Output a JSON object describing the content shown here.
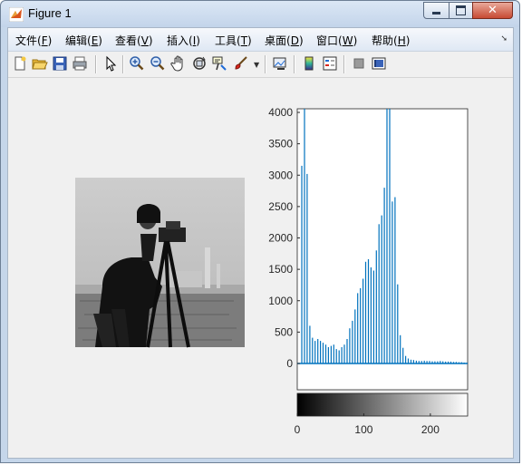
{
  "window": {
    "title": "Figure 1"
  },
  "menu": {
    "items": [
      {
        "text": "文件(",
        "key": "F",
        "close": ")"
      },
      {
        "text": "编辑(",
        "key": "E",
        "close": ")"
      },
      {
        "text": "查看(",
        "key": "V",
        "close": ")"
      },
      {
        "text": "插入(",
        "key": "I",
        "close": ")"
      },
      {
        "text": "工具(",
        "key": "T",
        "close": ")"
      },
      {
        "text": "桌面(",
        "key": "D",
        "close": ")"
      },
      {
        "text": "窗口(",
        "key": "W",
        "close": ")"
      },
      {
        "text": "帮助(",
        "key": "H",
        "close": ")"
      }
    ]
  },
  "toolbar": {
    "icons": [
      "new-figure-icon",
      "open-file-icon",
      "save-icon",
      "print-icon",
      "pointer-icon",
      "zoom-in-icon",
      "zoom-out-icon",
      "pan-icon",
      "rotate-3d-icon",
      "data-cursor-icon",
      "brush-icon",
      "brush-dropdown-icon",
      "link-plot-icon",
      "colorbar-icon",
      "legend-icon",
      "hide-plot-tools-icon",
      "show-plot-tools-icon"
    ]
  },
  "colors": {
    "bar": "#0072bd",
    "axes_bg": "#ffffff",
    "figure_bg": "#f0f0f0"
  },
  "chart_data": {
    "type": "bar",
    "title": "",
    "xlabel": "",
    "ylabel": "",
    "xlim": [
      0,
      256
    ],
    "ylim": [
      0,
      4100
    ],
    "yticks": [
      0,
      500,
      1000,
      1500,
      2000,
      2500,
      3000,
      3500,
      4000
    ],
    "xticks": [
      0,
      100,
      200
    ],
    "colorbar": "grayscale 0-255 below x axis",
    "x": [
      0,
      4,
      8,
      12,
      16,
      20,
      24,
      28,
      32,
      36,
      40,
      44,
      48,
      52,
      56,
      60,
      64,
      68,
      72,
      76,
      80,
      84,
      88,
      92,
      96,
      100,
      104,
      108,
      112,
      116,
      120,
      124,
      128,
      132,
      136,
      140,
      144,
      148,
      152,
      156,
      160,
      164,
      168,
      172,
      176,
      180,
      184,
      188,
      192,
      196,
      200,
      204,
      208,
      212,
      216,
      220,
      224,
      228,
      232,
      236,
      240,
      244,
      248,
      252
    ],
    "values": [
      0,
      3150,
      4100,
      3020,
      600,
      410,
      360,
      390,
      360,
      330,
      300,
      260,
      280,
      300,
      230,
      210,
      260,
      300,
      390,
      560,
      680,
      860,
      1120,
      1200,
      1350,
      1620,
      1660,
      1530,
      1480,
      1800,
      2220,
      2360,
      2800,
      4100,
      4100,
      2580,
      2650,
      1260,
      450,
      250,
      120,
      80,
      60,
      55,
      45,
      40,
      40,
      45,
      40,
      40,
      35,
      35,
      35,
      40,
      35,
      30,
      30,
      30,
      25,
      25,
      20,
      20,
      15,
      10
    ]
  }
}
